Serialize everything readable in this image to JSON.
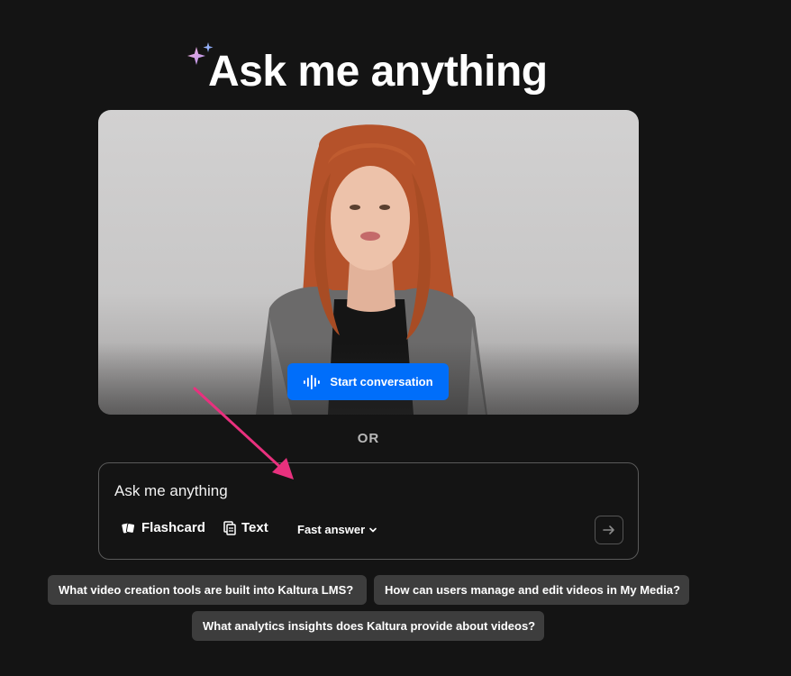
{
  "header": {
    "title": "Ask me anything",
    "sparkle_icon": "sparkle-icon"
  },
  "video": {
    "start_button_label": "Start conversation",
    "start_icon": "audio-wave-icon",
    "accent": "#006efa"
  },
  "divider": {
    "label": "OR"
  },
  "ask": {
    "placeholder": "Ask me anything",
    "tools": [
      {
        "label": "Flashcard",
        "icon": "flashcard-icon"
      },
      {
        "label": "Text",
        "icon": "text-doc-icon"
      }
    ],
    "mode": {
      "selected": "Fast answer",
      "icon": "chevron-down-icon"
    },
    "send_icon": "arrow-right-icon"
  },
  "suggestions": [
    "What video creation tools are built into Kaltura LMS?",
    "How can users manage and edit videos in My Media?",
    "What analytics insights does Kaltura provide about videos?"
  ],
  "annotation": {
    "color": "#e8317e"
  }
}
